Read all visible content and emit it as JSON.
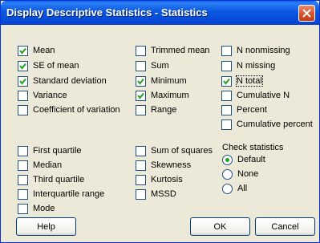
{
  "window": {
    "title": "Display Descriptive Statistics - Statistics"
  },
  "col1": [
    {
      "label": "Mean",
      "checked": true
    },
    {
      "label": "SE of mean",
      "checked": true
    },
    {
      "label": "Standard deviation",
      "checked": true
    },
    {
      "label": "Variance",
      "checked": false
    },
    {
      "label": "Coefficient of variation",
      "checked": false
    }
  ],
  "col2": [
    {
      "label": "Trimmed mean",
      "checked": false
    },
    {
      "label": "Sum",
      "checked": false
    },
    {
      "label": "Minimum",
      "checked": true
    },
    {
      "label": "Maximum",
      "checked": true
    },
    {
      "label": "Range",
      "checked": false
    }
  ],
  "col3": [
    {
      "label": "N nonmissing",
      "checked": false
    },
    {
      "label": "N missing",
      "checked": false
    },
    {
      "label": "N total",
      "checked": true
    },
    {
      "label": "Cumulative N",
      "checked": false
    },
    {
      "label": "Percent",
      "checked": false
    },
    {
      "label": "Cumulative percent",
      "checked": false
    }
  ],
  "col1b": [
    {
      "label": "First quartile",
      "checked": false
    },
    {
      "label": "Median",
      "checked": false
    },
    {
      "label": "Third quartile",
      "checked": false
    },
    {
      "label": "Interquartile range",
      "checked": false
    },
    {
      "label": "Mode",
      "checked": false
    }
  ],
  "col2b": [
    {
      "label": "Sum of squares",
      "checked": false
    },
    {
      "label": "Skewness",
      "checked": false
    },
    {
      "label": "Kurtosis",
      "checked": false
    },
    {
      "label": "MSSD",
      "checked": false
    }
  ],
  "check_statistics": {
    "label": "Check statistics",
    "options": [
      {
        "label": "Default",
        "selected": true
      },
      {
        "label": "None",
        "selected": false
      },
      {
        "label": "All",
        "selected": false
      }
    ]
  },
  "buttons": {
    "help": "Help",
    "ok": "OK",
    "cancel": "Cancel"
  }
}
